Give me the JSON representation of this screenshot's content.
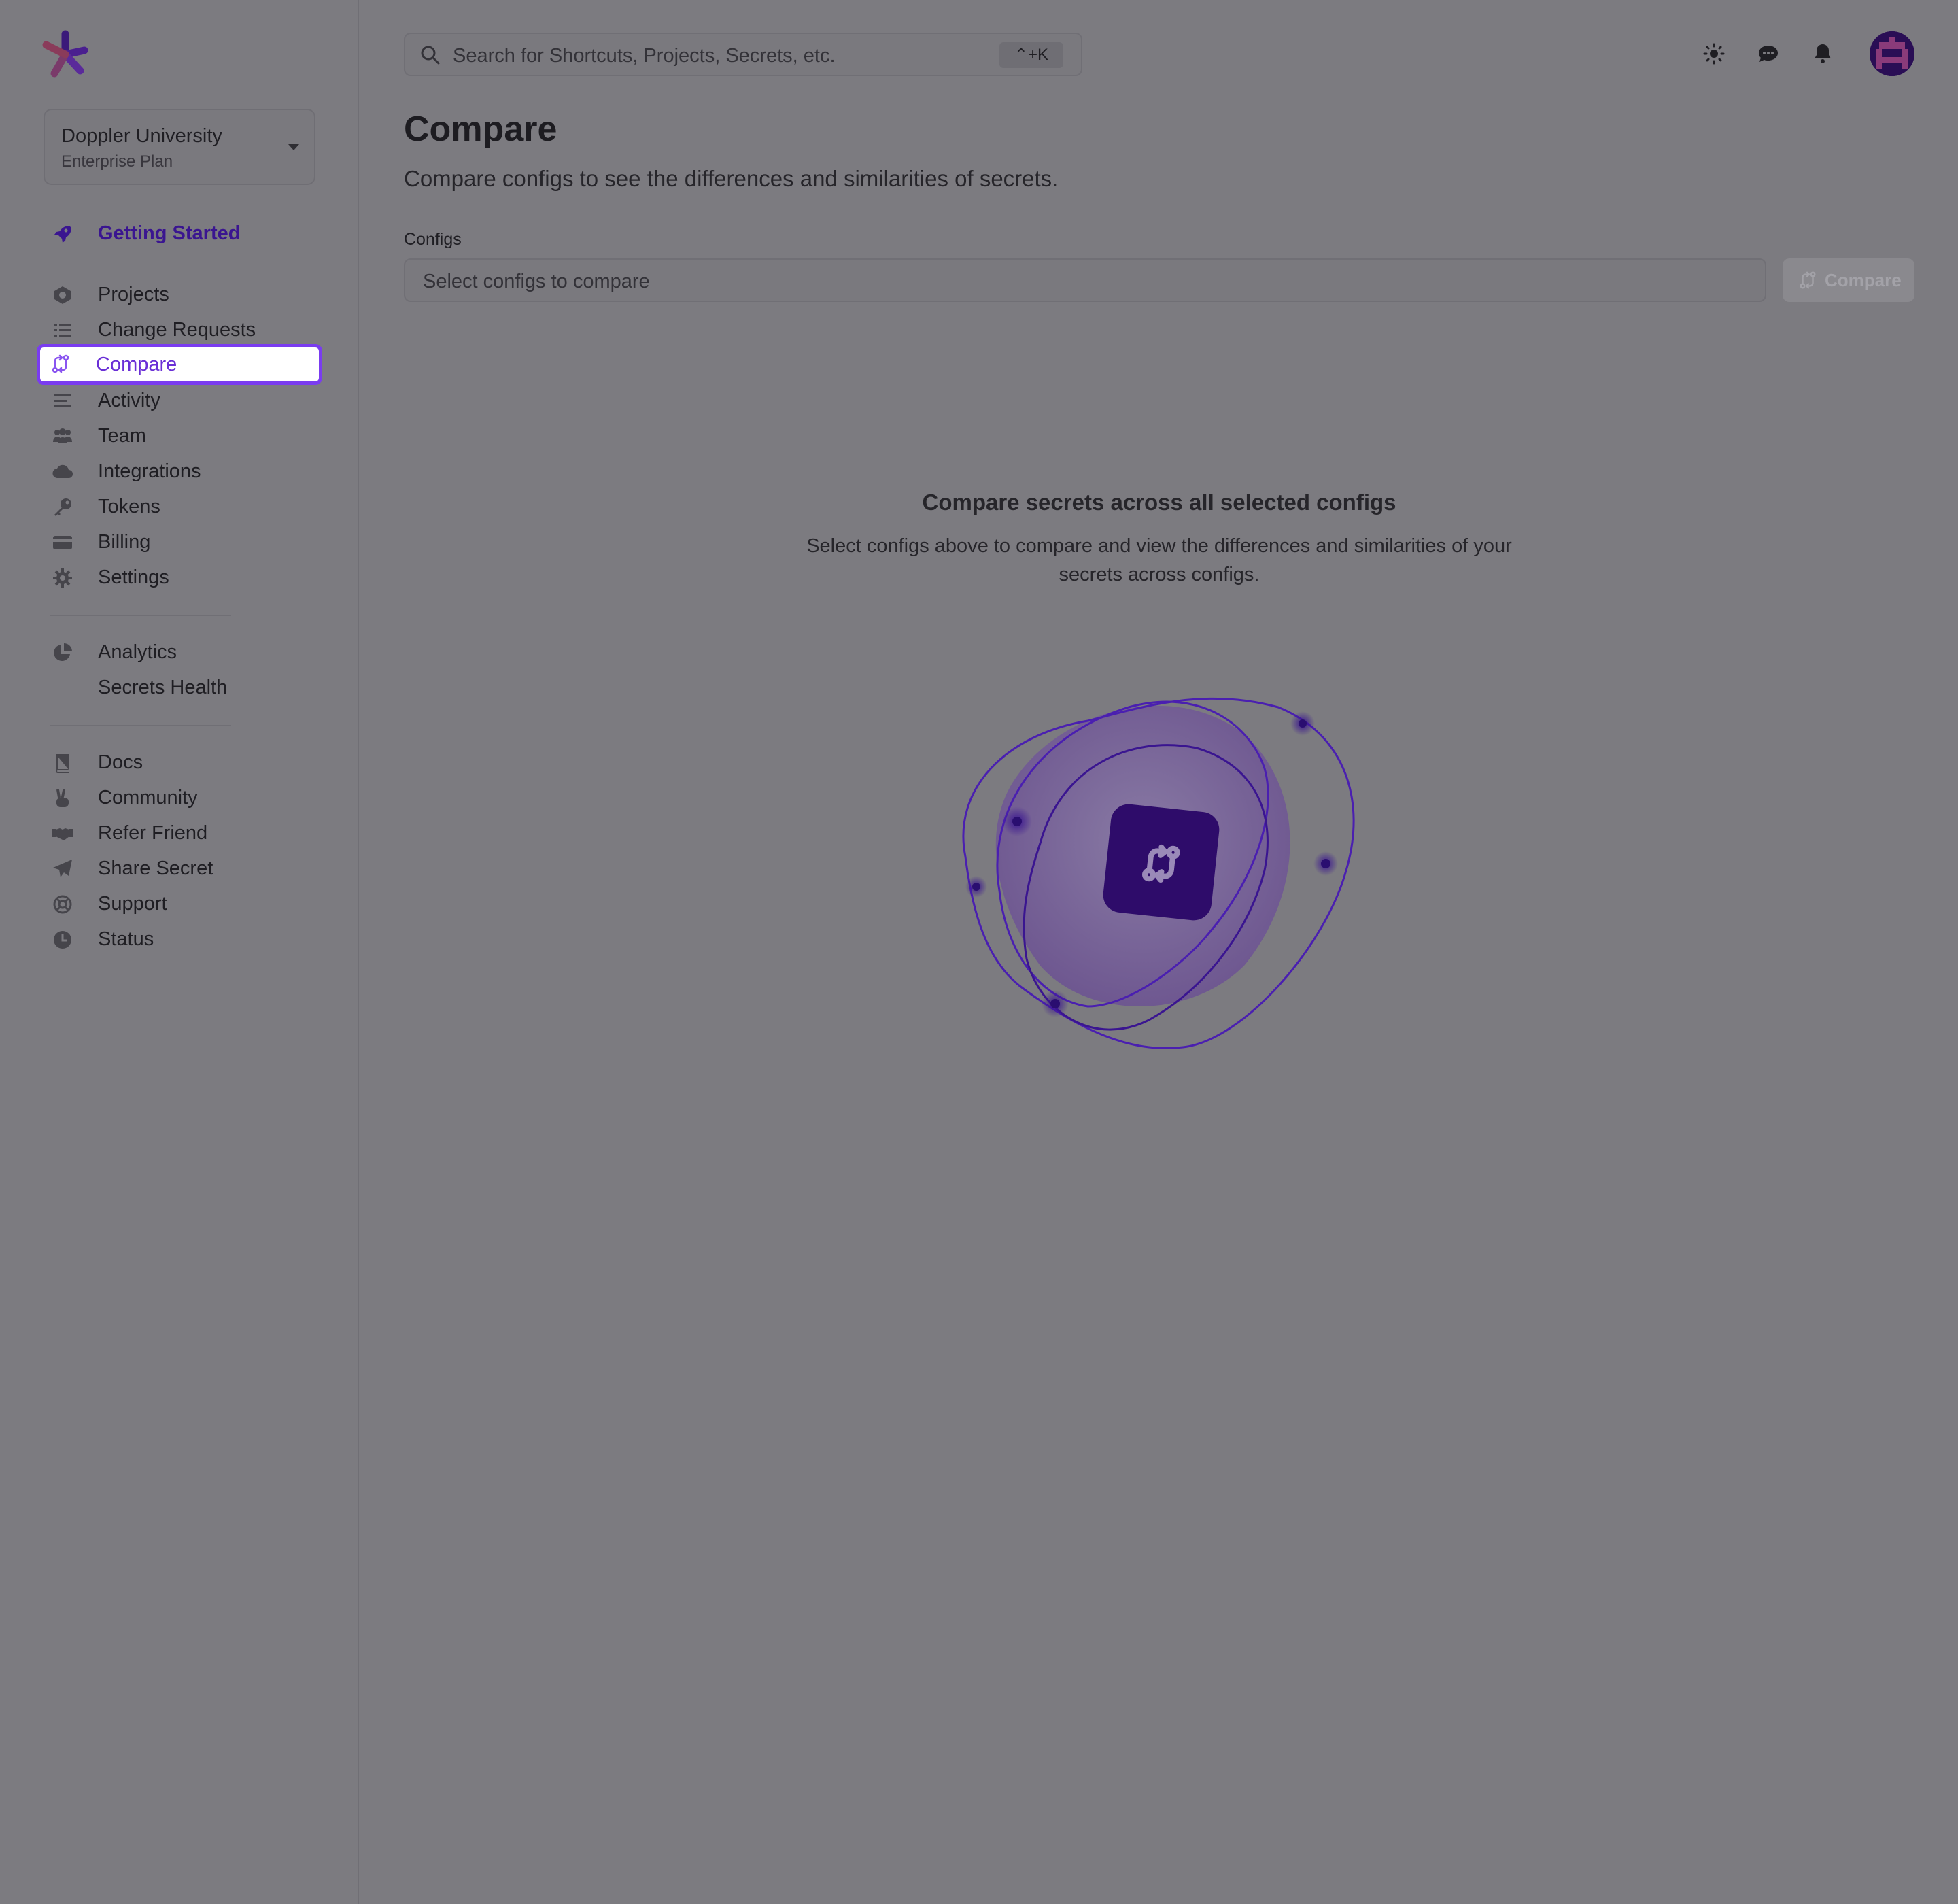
{
  "workspace": {
    "name": "Doppler University",
    "plan": "Enterprise Plan"
  },
  "sidebar": {
    "getting_started": {
      "label": "Getting Started",
      "icon": "rocket-icon"
    },
    "main_items": [
      {
        "label": "Projects",
        "icon": "projects-icon"
      },
      {
        "label": "Change Requests",
        "icon": "list-check-icon"
      },
      {
        "label": "Compare",
        "icon": "compare-icon",
        "active": true
      },
      {
        "label": "Activity",
        "icon": "activity-icon"
      },
      {
        "label": "Team",
        "icon": "team-icon"
      },
      {
        "label": "Integrations",
        "icon": "cloud-icon"
      },
      {
        "label": "Tokens",
        "icon": "key-icon"
      },
      {
        "label": "Billing",
        "icon": "credit-card-icon"
      },
      {
        "label": "Settings",
        "icon": "gear-icon"
      }
    ],
    "analytics_items": [
      {
        "label": "Analytics",
        "icon": "pie-chart-icon"
      },
      {
        "label": "Secrets Health",
        "icon": ""
      }
    ],
    "resource_items": [
      {
        "label": "Docs",
        "icon": "book-icon"
      },
      {
        "label": "Community",
        "icon": "peace-hand-icon"
      },
      {
        "label": "Refer Friend",
        "icon": "handshake-icon"
      },
      {
        "label": "Share Secret",
        "icon": "paper-plane-icon"
      },
      {
        "label": "Support",
        "icon": "lifebuoy-icon"
      },
      {
        "label": "Status",
        "icon": "clock-icon"
      }
    ]
  },
  "search": {
    "placeholder": "Search for Shortcuts, Projects, Secrets, etc.",
    "shortcut": "⌃+K"
  },
  "page": {
    "title": "Compare",
    "subtitle": "Compare configs to see the differences and similarities of secrets.",
    "configs_label": "Configs",
    "configs_placeholder": "Select configs to compare",
    "compare_button": "Compare"
  },
  "empty_state": {
    "title": "Compare secrets across all selected configs",
    "description": "Select configs above to compare and view the differences and similarities of your secrets across configs."
  },
  "colors": {
    "accent": "#7a3cf0",
    "brand_dark": "#2a0e55",
    "overlay": "#7c7b80"
  }
}
